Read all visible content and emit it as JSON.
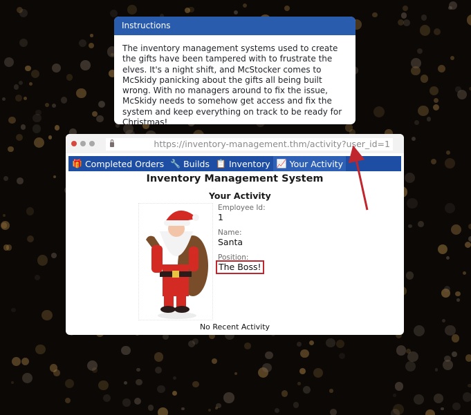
{
  "instructions": {
    "header": "Instructions",
    "body": "The inventory management systems used to create the gifts have been tampered with to frustrate the elves. It's a night shift, and McStocker comes to McSkidy panicking about the gifts all being built wrong. With no managers around to fix the issue, McSkidy needs to somehow get access and fix the system and keep everything on track to be ready for Christmas!"
  },
  "browser": {
    "url": "https://inventory-management.thm/activity?user_id=1",
    "traffic_light_colors": [
      "#d6493f",
      "#a8a8a8",
      "#a8a8a8"
    ]
  },
  "nav": {
    "items": [
      {
        "label": "Completed Orders",
        "icon": "gift-icon"
      },
      {
        "label": "Builds",
        "icon": "wrench-icon"
      },
      {
        "label": "Inventory",
        "icon": "clipboard-icon"
      },
      {
        "label": "Your Activity",
        "icon": "chart-icon",
        "active": true
      }
    ]
  },
  "page": {
    "title": "Inventory Management System",
    "section_title": "Your Activity",
    "employee_id_label": "Employee Id:",
    "employee_id": "1",
    "name_label": "Name:",
    "name": "Santa",
    "position_label": "Position:",
    "position": "The Boss!",
    "recent_activity": "No Recent Activity"
  },
  "colors": {
    "nav_bg": "#1d4ea3",
    "instructions_header_bg": "#2a5cae",
    "highlight_red": "#c0262d"
  }
}
